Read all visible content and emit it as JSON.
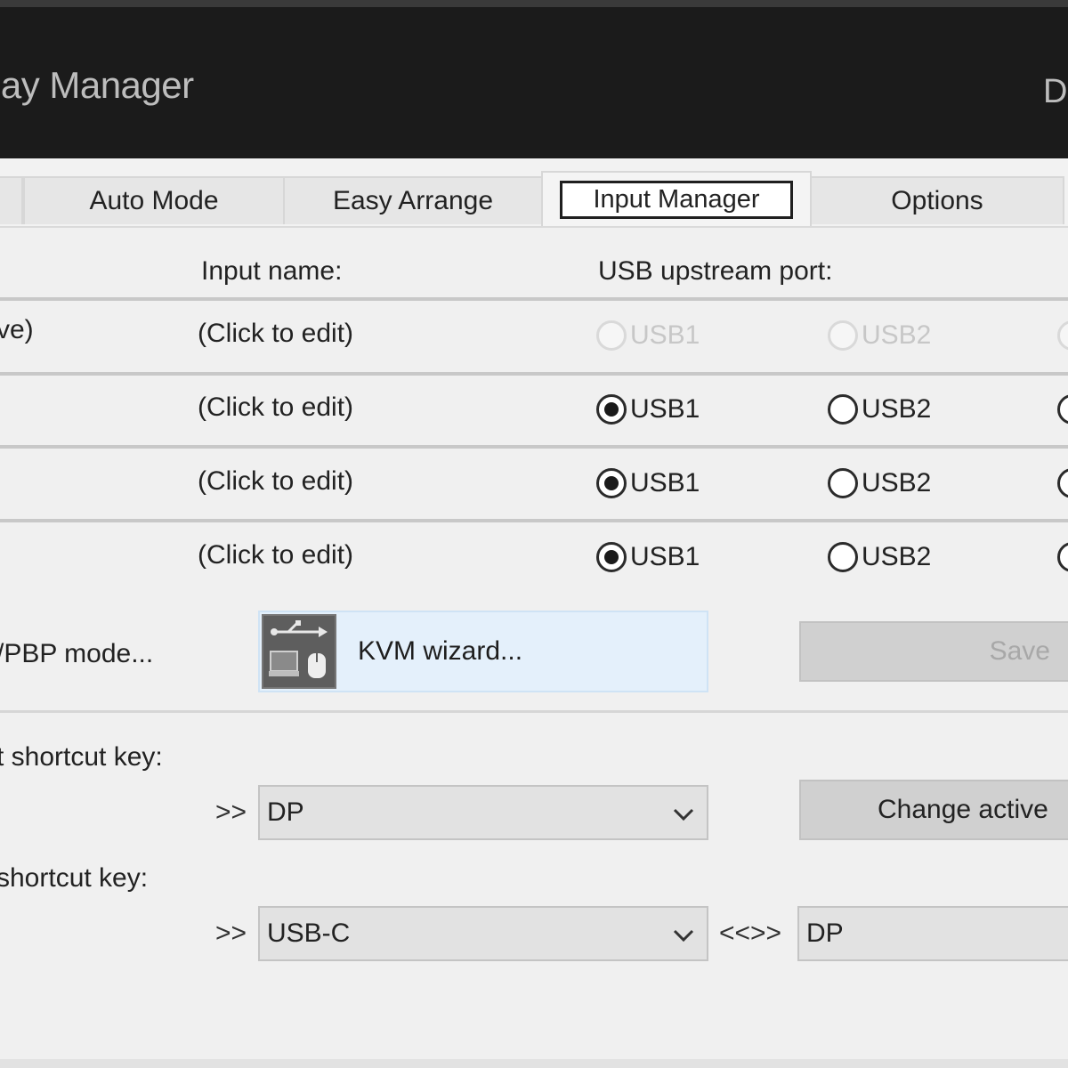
{
  "window": {
    "title_visible": "lay Manager",
    "title_right_fragment": "D"
  },
  "tabs": [
    {
      "label": "Auto Mode",
      "active": false
    },
    {
      "label": "Easy Arrange",
      "active": false
    },
    {
      "label": "Input Manager",
      "active": true
    },
    {
      "label": "Options",
      "active": false
    }
  ],
  "table": {
    "headers": {
      "input_name": "Input name:",
      "usb_port": "USB upstream port:"
    },
    "rows": [
      {
        "left_fragment": "ve)",
        "input_name": "(Click to edit)",
        "usb1": "USB1",
        "usb2": "USB2",
        "selected": "none",
        "disabled": true
      },
      {
        "left_fragment": "",
        "input_name": "(Click to edit)",
        "usb1": "USB1",
        "usb2": "USB2",
        "selected": "USB1",
        "disabled": false
      },
      {
        "left_fragment": "",
        "input_name": "(Click to edit)",
        "usb1": "USB1",
        "usb2": "USB2",
        "selected": "USB1",
        "disabled": false
      },
      {
        "left_fragment": "",
        "input_name": "(Click to edit)",
        "usb1": "USB1",
        "usb2": "USB2",
        "selected": "USB1",
        "disabled": false
      }
    ]
  },
  "actions": {
    "pbp_fragment": "/PBP mode...",
    "kvm_wizard": "KVM wizard...",
    "save": "Save"
  },
  "shortcuts": {
    "first_label_fragment": "t shortcut key:",
    "first_arrows": ">>",
    "first_select": "DP",
    "change_active_fragment": "Change active",
    "second_label_fragment": "shortcut key:",
    "second_arrows": ">>",
    "second_select": "USB-C",
    "swap_arrows": "<<>>",
    "third_select": "DP"
  },
  "colors": {
    "titlebar": "#1b1b1b",
    "kvm_button_bg": "#e4f0fb",
    "window_bg": "#f0f0f0"
  },
  "icons": {
    "kvm_wizard": "usb-kvm-icon",
    "dropdown": "chevron-down-icon"
  }
}
